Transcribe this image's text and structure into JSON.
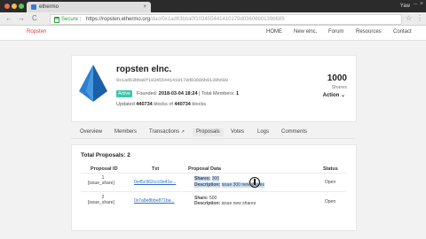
{
  "browser": {
    "tab_title": "ethermo",
    "tab_close": "×",
    "user": "Yaw",
    "win_min": "–",
    "win_close": "×",
    "back": "←",
    "forward": "→",
    "reload": "C",
    "secure_label": "Secure",
    "url_sep": "|",
    "url_host": "https://ropsten.ethermo.org",
    "url_path": "/dao/0x1ad63bba0f103455441410179d03606b0139b689",
    "star": "☆",
    "menu": "⋮"
  },
  "nav": {
    "brand": "Ropsten",
    "links": [
      "HOME",
      "New elnc.",
      "Forum",
      "Resources",
      "Contact"
    ]
  },
  "dao": {
    "name": "ropsten elnc.",
    "address": "0x1ad63bba0f103455441410179d03606b0139b689",
    "status": "Active",
    "founded_label": "Founded:",
    "founded_value": "2018-03-04 18:24",
    "members_label": "| Total Members:",
    "members_value": "1",
    "updated_prefix": "Updated",
    "updated_blocks": "440734",
    "updated_mid": "blocks of",
    "updated_total": "440734",
    "updated_suffix": "blocks",
    "shares_count": "1000",
    "shares_label": "Shares",
    "action_label": "Action",
    "action_chevron": "⌄",
    "colors": {
      "brand": "#d0433a",
      "badge": "#3cc7a8",
      "link": "#2b6cc4"
    }
  },
  "tabs": [
    {
      "label": "Overview"
    },
    {
      "label": "Members"
    },
    {
      "label": "Transactions",
      "ext": "↗"
    },
    {
      "label": "Proposals",
      "active": true
    },
    {
      "label": "Votes"
    },
    {
      "label": "Logs"
    },
    {
      "label": "Comments"
    }
  ],
  "proposals": {
    "total_label": "Total Proposals: 2",
    "columns": [
      "Proposal ID",
      "Txt",
      "Proposal Data",
      "Status"
    ],
    "rows": [
      {
        "id": "1",
        "type": "[issue_share]",
        "tx": "0x45c962ccc9e41e...",
        "data_label_1": "Shares:",
        "data_value_1": "300",
        "data_label_2": "Description:",
        "data_value_2": "issue 300 new shares",
        "status": "Open"
      },
      {
        "id": "2",
        "type": "[issue_share]",
        "tx": "0x7a8e8bbe871ba...",
        "data_label_1": "Share:",
        "data_value_1": "500",
        "data_label_2": "Description:",
        "data_value_2": "issue new shares",
        "status": "Open"
      }
    ]
  }
}
